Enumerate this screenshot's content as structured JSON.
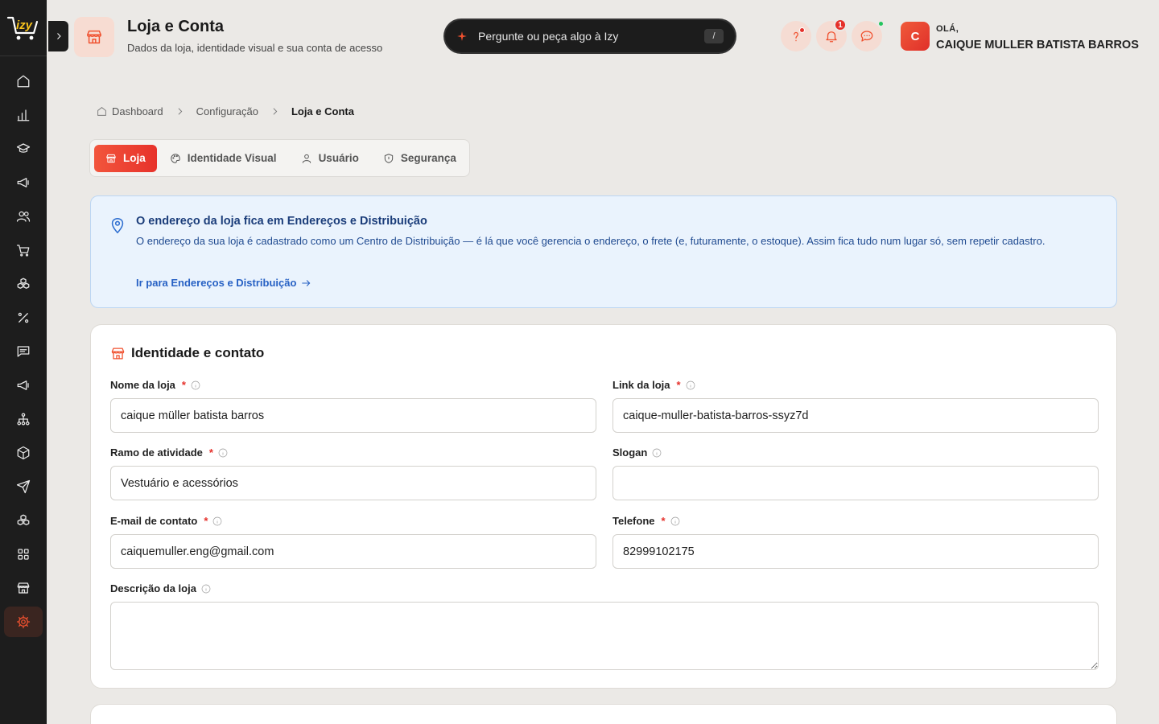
{
  "header": {
    "title": "Loja e Conta",
    "subtitle": "Dados da loja, identidade visual e sua conta de acesso",
    "ask_placeholder": "Pergunte ou peça algo à Izy",
    "ask_shortcut": "/",
    "notifications_count": "1",
    "greeting": "OLÁ,",
    "user_name": "CAIQUE MULLER BATISTA BARROS",
    "avatar_initial": "C"
  },
  "brand": {
    "logo_text": "izy",
    "accent": "#f0512f"
  },
  "sidebar": {
    "items": [
      {
        "icon": "home-icon"
      },
      {
        "icon": "bar-chart-icon"
      },
      {
        "icon": "graduation-cap-icon"
      },
      {
        "icon": "megaphone-icon"
      },
      {
        "icon": "users-icon"
      },
      {
        "icon": "shopping-cart-icon"
      },
      {
        "icon": "boxes-icon"
      },
      {
        "icon": "percent-icon"
      },
      {
        "icon": "message-icon"
      },
      {
        "icon": "megaphone-icon"
      },
      {
        "icon": "network-icon"
      },
      {
        "icon": "package-icon"
      },
      {
        "icon": "send-icon"
      },
      {
        "icon": "boxes-icon"
      },
      {
        "icon": "grid-icon"
      },
      {
        "icon": "store-icon"
      },
      {
        "icon": "settings-icon",
        "active": true
      }
    ]
  },
  "breadcrumb": {
    "home": "Dashboard",
    "middle": "Configuração",
    "current": "Loja e Conta"
  },
  "tabs": [
    {
      "label": "Loja",
      "active": true
    },
    {
      "label": "Identidade Visual"
    },
    {
      "label": "Usuário"
    },
    {
      "label": "Segurança"
    }
  ],
  "notice": {
    "title": "O endereço da loja fica em Endereços e Distribuição",
    "body": "O endereço da sua loja é cadastrado como um Centro de Distribuição — é lá que você gerencia o endereço, o frete (e, futuramente, o estoque). Assim fica tudo num lugar só, sem repetir cadastro.",
    "link": "Ir para Endereços e Distribuição"
  },
  "card": {
    "title": "Identidade e contato",
    "fields": {
      "store_name": {
        "label": "Nome da loja",
        "required": "*",
        "value": "caique müller batista barros"
      },
      "store_link": {
        "label": "Link da loja",
        "required": "*",
        "value": "caique-muller-batista-barros-ssyz7d"
      },
      "business": {
        "label": "Ramo de atividade",
        "required": "*",
        "value": "Vestuário e acessórios"
      },
      "slogan": {
        "label": "Slogan",
        "value": ""
      },
      "email": {
        "label": "E-mail de contato",
        "required": "*",
        "value": "caiquemuller.eng@gmail.com"
      },
      "phone": {
        "label": "Telefone",
        "required": "*",
        "value": "82999102175"
      },
      "description": {
        "label": "Descrição da loja",
        "value": ""
      }
    }
  }
}
